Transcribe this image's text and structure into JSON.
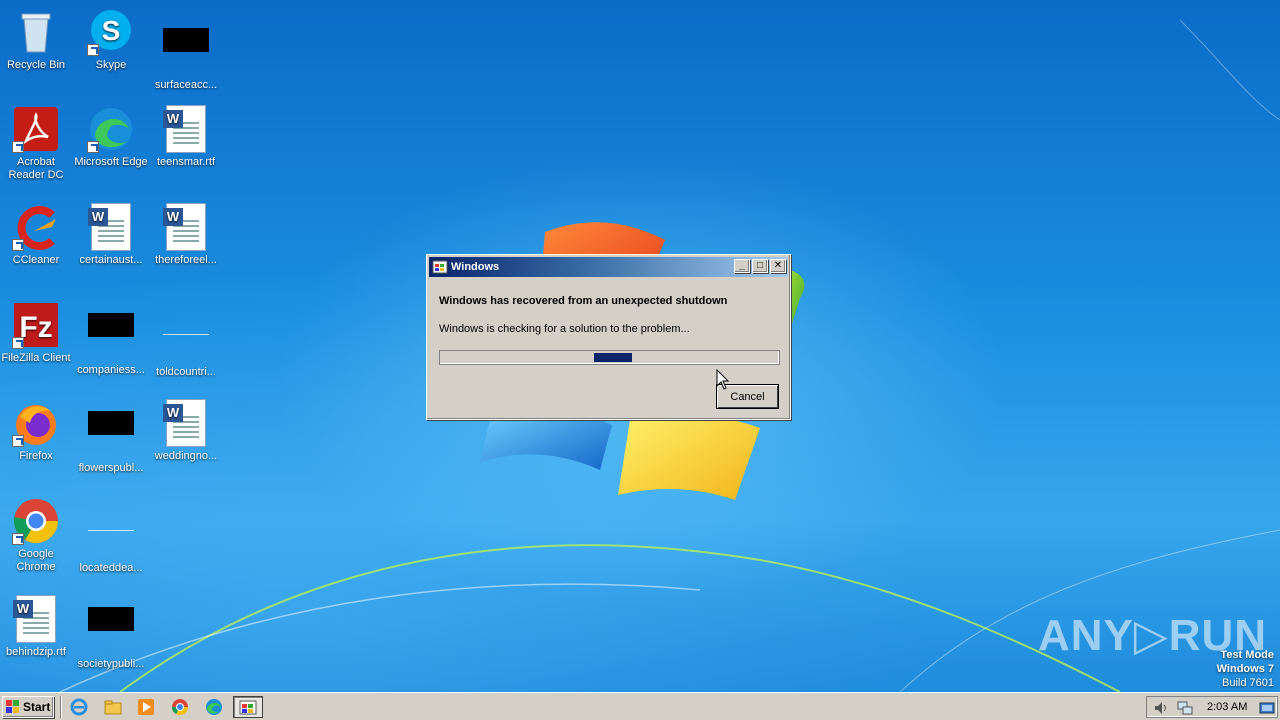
{
  "desktop": {
    "icons": [
      {
        "label": "Recycle Bin",
        "icon": "recycle-bin-icon"
      },
      {
        "label": "Skype",
        "icon": "skype-icon"
      },
      {
        "label": "surfaceacc...",
        "icon": "file-icon"
      },
      {
        "label": "Acrobat Reader DC",
        "icon": "acrobat-icon"
      },
      {
        "label": "Microsoft Edge",
        "icon": "edge-icon"
      },
      {
        "label": "teensmar.rtf",
        "icon": "word-document-icon"
      },
      {
        "label": "CCleaner",
        "icon": "ccleaner-icon"
      },
      {
        "label": "certainaust...",
        "icon": "word-document-icon"
      },
      {
        "label": "thereforeel...",
        "icon": "word-document-icon"
      },
      {
        "label": "FileZilla Client",
        "icon": "filezilla-icon"
      },
      {
        "label": "companiess...",
        "icon": "file-icon"
      },
      {
        "label": "toldcountri...",
        "icon": "file-icon"
      },
      {
        "label": "Firefox",
        "icon": "firefox-icon"
      },
      {
        "label": "flowerspubl...",
        "icon": "file-icon"
      },
      {
        "label": "weddingno...",
        "icon": "word-document-icon"
      },
      {
        "label": "Google Chrome",
        "icon": "chrome-icon"
      },
      {
        "label": "locateddea...",
        "icon": "file-icon"
      },
      {
        "label": "behindzip.rtf",
        "icon": "word-document-icon"
      },
      {
        "label": "societypubli...",
        "icon": "file-icon"
      }
    ]
  },
  "dialog": {
    "title": "Windows",
    "heading": "Windows has recovered from an unexpected shutdown",
    "message": "Windows is checking for a solution to the problem...",
    "cancel_label": "Cancel",
    "progress_marquee_position": 0.455
  },
  "watermark": {
    "text": "ANY▷RUN",
    "line1": "Test Mode",
    "line2": "Windows 7",
    "line3": "Build 7601"
  },
  "taskbar": {
    "start_label": "Start",
    "clock": "2:03 AM",
    "quick_launch": [
      "ie-icon",
      "explorer-icon",
      "media-player-icon",
      "chrome-icon",
      "edge-icon"
    ],
    "active_task": "windows-dialog-task"
  },
  "colors": {
    "dialog_face": "#d4d0c8",
    "titlebar_start": "#0a246a",
    "titlebar_end": "#a6caf0",
    "progress_chunk": "#0a246a"
  }
}
